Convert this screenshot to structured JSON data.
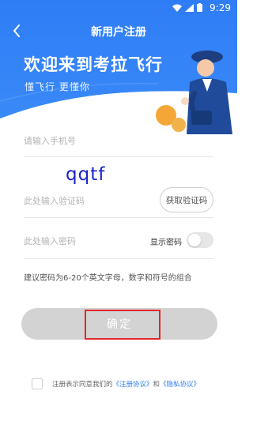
{
  "colors": {
    "primary": "#2f7df6",
    "button_disabled": "#d3d3d3",
    "annotation_red": "#e1262c",
    "handwriting": "#1a22c8"
  },
  "status_bar": {
    "time": "9:29"
  },
  "nav": {
    "title": "新用户注册",
    "back_icon": "chevron-left-icon"
  },
  "hero": {
    "title": "欢迎来到考拉飞行",
    "subtitle": "懂飞行 更懂你",
    "illustration": "pilot-illustration"
  },
  "form": {
    "phone_placeholder": "请输入手机号",
    "code_placeholder": "此处输入验证码",
    "get_code_label": "获取验证码",
    "password_placeholder": "此处输入密码",
    "show_password_label": "显示密码",
    "show_password_on": false,
    "handwritten_code": "qqtf"
  },
  "hint": "建议密码为6-20个英文字母，数字和符号的组合",
  "confirm_label": "确定",
  "agreement": {
    "prefix": "注册表示同意我们的",
    "register_link": "《注册协议》",
    "and": "和",
    "privacy_link": "《隐私协议》",
    "checked": false
  }
}
